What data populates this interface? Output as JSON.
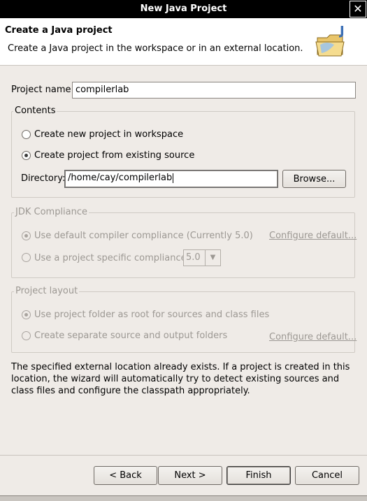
{
  "window": {
    "title": "New Java Project",
    "close_glyph": "✕"
  },
  "banner": {
    "title": "Create a Java project",
    "description": "Create a Java project in the workspace or in an external location.",
    "icon": "java-project-folder-icon"
  },
  "project_name": {
    "label": "Project name:",
    "value": "compilerlab"
  },
  "contents": {
    "title": "Contents",
    "option_new": "Create new project in workspace",
    "option_existing": "Create project from existing source",
    "selected": "existing",
    "directory_label": "Directory:",
    "directory_value": "/home/cay/compilerlab",
    "browse_label": "Browse..."
  },
  "jdk": {
    "title": "JDK Compliance",
    "option_default": "Use default compiler compliance (Currently 5.0)",
    "option_specific": "Use a project specific compliance:",
    "compliance_value": "5.0",
    "configure_link": "Configure default..."
  },
  "layout": {
    "title": "Project layout",
    "option_root": "Use project folder as root for sources and class files",
    "option_separate": "Create separate source and output folders",
    "configure_link": "Configure default..."
  },
  "info_text": "The specified external location already exists. If a project is created in this location, the wizard will automatically try to detect existing sources and class files and configure the classpath appropriately.",
  "buttons": {
    "back": "< Back",
    "next": "Next >",
    "finish": "Finish",
    "cancel": "Cancel"
  }
}
